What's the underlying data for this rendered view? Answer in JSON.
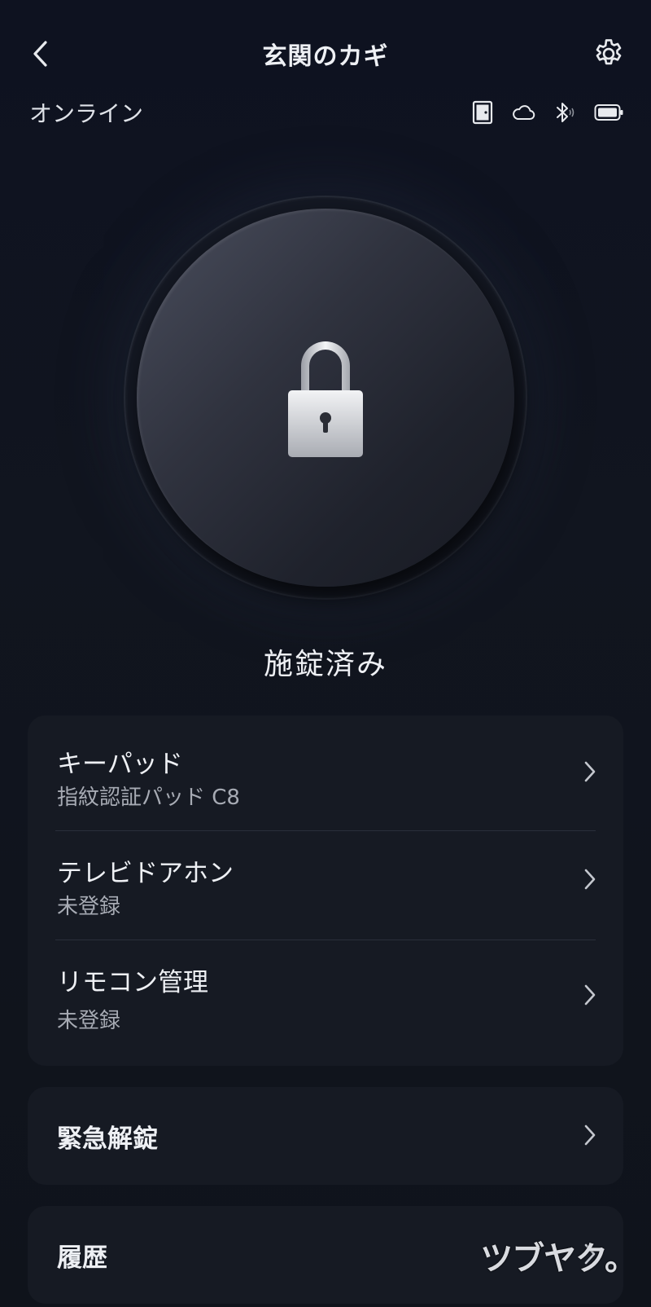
{
  "header": {
    "title": "玄関のカギ"
  },
  "status": {
    "text": "オンライン",
    "icons": [
      "door-icon",
      "cloud-icon",
      "bluetooth-icon",
      "battery-icon"
    ]
  },
  "lock": {
    "state": "施錠済み"
  },
  "devices": [
    {
      "title": "キーパッド",
      "subtitle": "指紋認証パッド C8"
    },
    {
      "title": "テレビドアホン",
      "subtitle": "未登録"
    },
    {
      "title": "リモコン管理",
      "subtitle": "未登録"
    }
  ],
  "emergency": {
    "label": "緊急解錠"
  },
  "history": {
    "label": "履歴"
  },
  "watermark": "ツブヤク。",
  "colors": {
    "background": "#0f131c",
    "card": "#161a23",
    "text": "#eef0f4",
    "subtext": "#a7abb4"
  }
}
